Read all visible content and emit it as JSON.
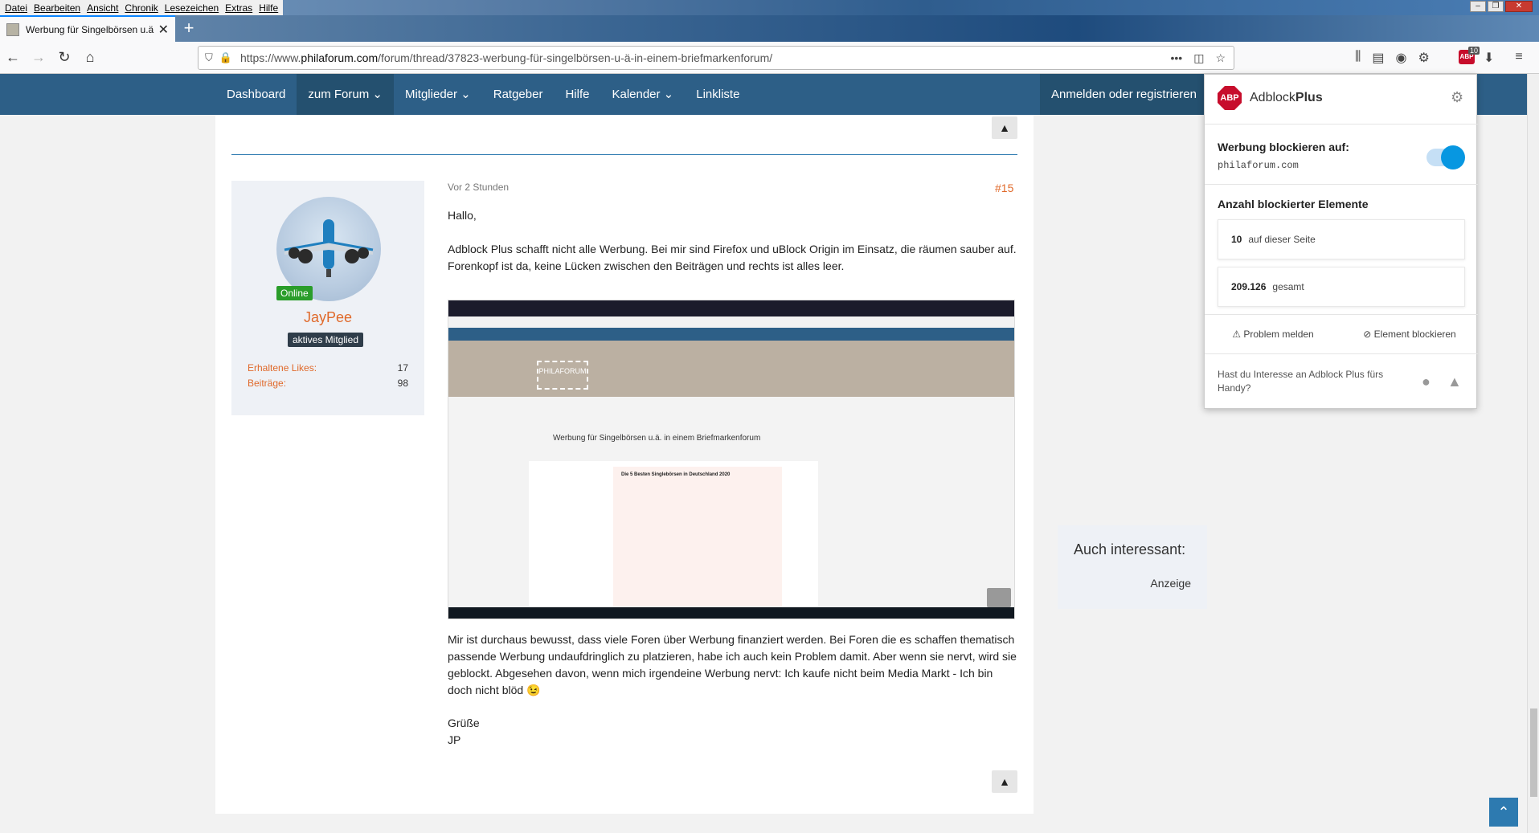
{
  "menubar": [
    "Datei",
    "Bearbeiten",
    "Ansicht",
    "Chronik",
    "Lesezeichen",
    "Extras",
    "Hilfe"
  ],
  "tab": {
    "title": "Werbung für Singelbörsen u.ä."
  },
  "url": {
    "prefix": "https://www.",
    "domain": "philaforum.com",
    "path": "/forum/thread/37823-werbung-für-singelbörsen-u-ä-in-einem-briefmarkenforum/"
  },
  "toolbar_badge": "10",
  "sitenav": {
    "items": [
      "Dashboard",
      "zum Forum ⌄",
      "Mitglieder ⌄",
      "Ratgeber",
      "Hilfe",
      "Kalender ⌄",
      "Linkliste"
    ],
    "login": "Anmelden oder registrieren"
  },
  "user": {
    "status": "Online",
    "name": "JayPee",
    "rank": "aktives Mitglied",
    "likes_label": "Erhaltene Likes:",
    "likes": "17",
    "posts_label": "Beiträge:",
    "posts": "98"
  },
  "post": {
    "time": "Vor 2 Stunden",
    "number": "#15",
    "greeting": "Hallo,",
    "para1": "Adblock Plus schafft nicht alle Werbung. Bei mir sind Firefox und uBlock Origin im Einsatz, die räumen sauber auf. Forenkopf ist da, keine Lücken zwischen den Beiträgen und rechts ist alles leer.",
    "para2": "Mir ist durchaus bewusst, dass viele Foren über Werbung finanziert werden. Bei Foren die es schaffen thematisch passende Werbung undaufdringlich zu platzieren, habe ich auch kein Problem damit. Aber wenn sie nervt, wird sie geblockt. Abgesehen davon, wenn mich irgendeine Werbung nervt: Ich kaufe nicht beim Media Markt - Ich bin doch nicht blöd 😉",
    "closing": "Grüße",
    "signature": "JP"
  },
  "screenshot": {
    "logo": "PHILAFORUM",
    "thread_title": "Werbung für Singelbörsen u.ä. in einem Briefmarkenforum",
    "ad_title": "Die 5 Besten Singlebörsen in Deutschland 2020"
  },
  "sidebox": {
    "title": "Auch interessant:",
    "ad": "Anzeige"
  },
  "abp": {
    "brand_a": "Adblock",
    "brand_b": "Plus",
    "block_label": "Werbung blockieren auf:",
    "domain": "philaforum.com",
    "count_label": "Anzahl blockierter Elemente",
    "page_count": "10",
    "page_label": "auf dieser Seite",
    "total_count": "209.126",
    "total_label": "gesamt",
    "report": "Problem melden",
    "block_element": "Element blockieren",
    "mobile": "Hast du Interesse an Adblock Plus fürs Handy?"
  }
}
